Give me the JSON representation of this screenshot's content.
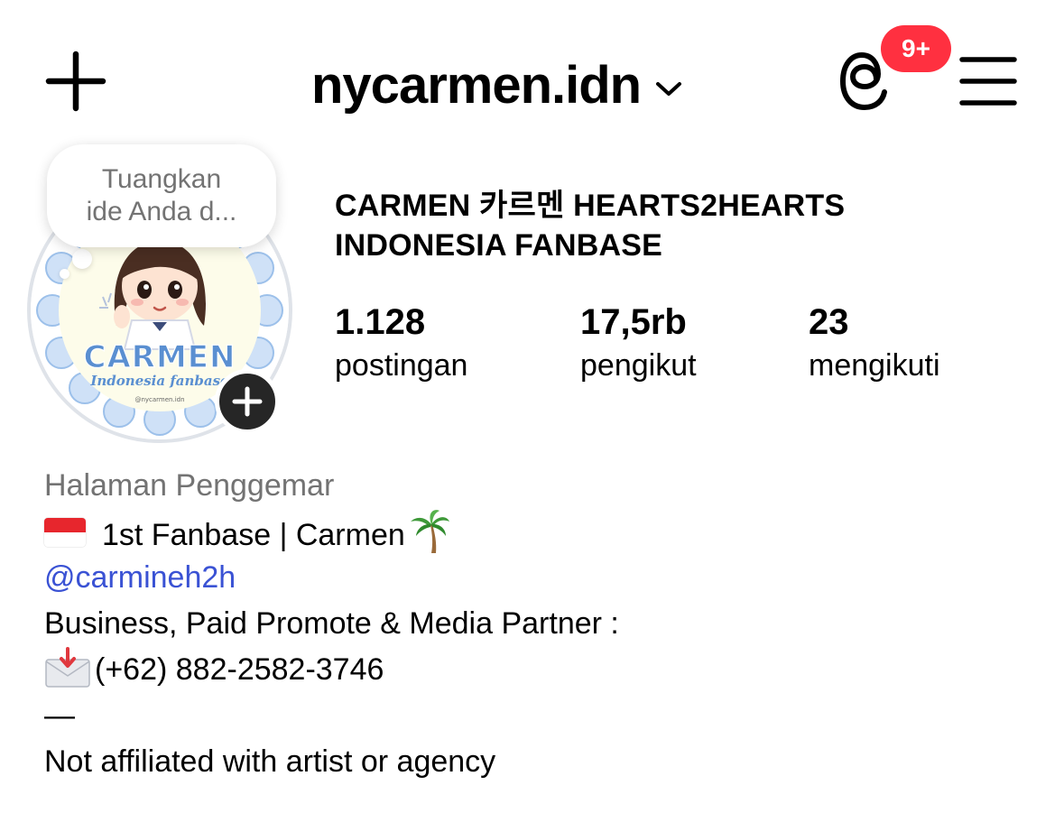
{
  "header": {
    "username": "nycarmen.idn",
    "notification_badge": "9+",
    "icons": [
      "plus-icon",
      "chevron-down-icon",
      "threads-icon",
      "hamburger-menu-icon"
    ],
    "badge_color": "#ff3040"
  },
  "note": {
    "line1": "Tuangkan",
    "line2": "ide Anda d..."
  },
  "avatar": {
    "logo_text": "CARMEN",
    "logo_subtext": "Indonesia fanbase",
    "watermark": "@nycarmen.idn"
  },
  "profile": {
    "display_name_line1": "CARMEN 카르멘 HEARTS2HEARTS",
    "display_name_line2": "INDONESIA FANBASE",
    "stats": [
      {
        "value": "1.128",
        "label": "postingan"
      },
      {
        "value": "17,5rb",
        "label": "pengikut"
      },
      {
        "value": "23",
        "label": "mengikuti"
      }
    ]
  },
  "bio": {
    "category": "Halaman Penggemar",
    "line1": "1st Fanbase | Carmen",
    "mention": "@carmineh2h",
    "line3": "Business, Paid Promote & Media Partner :",
    "phone": "(+62) 882-2582-3746",
    "separator": "—",
    "disclaimer": "Not affiliated with artist or agency",
    "emoji_icons": [
      "indonesia-flag-icon",
      "palm-tree-icon",
      "envelope-with-arrow-icon"
    ],
    "mention_color": "#3a52d4"
  }
}
